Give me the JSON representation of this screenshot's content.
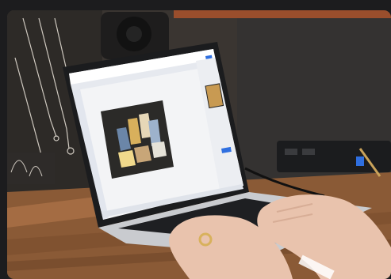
{
  "scene": {
    "subject": "laptop-on-wooden-desk-with-hands-typing",
    "palette": {
      "wall_left": "#4b4238",
      "wall_right": "#3a3836",
      "desk_wood": "#8a5a36",
      "desk_wood_dark": "#5b3a22",
      "laptop_body": "#c9cbcf",
      "laptop_keys": "#1e1f22",
      "screen_bg": "#f3f4f6",
      "app_accent": "#2f6fe0",
      "photo_bg": "#2b2a28",
      "skin": "#e9c3ad",
      "ring": "#d8b15c",
      "jewelry_pad": "#2e2b29",
      "shelf_top": "#9a4e2c"
    },
    "icons": [
      "speaker-icon",
      "jewelry-necklace-icon",
      "ring-icon"
    ]
  }
}
